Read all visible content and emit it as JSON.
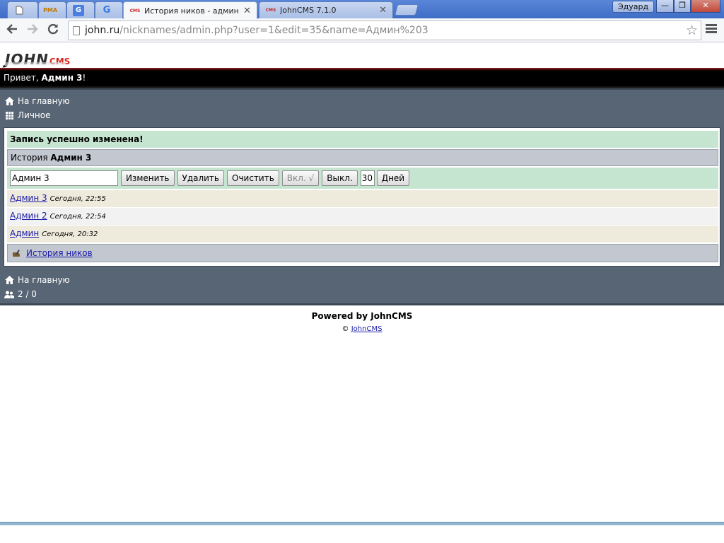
{
  "browser": {
    "tabs": [
      {
        "label": "",
        "favicon": "page-icon"
      },
      {
        "label": "",
        "favicon": "pma-icon",
        "favicon_text": "PMA"
      },
      {
        "label": "",
        "favicon": "google-translate-icon",
        "favicon_text": "G"
      },
      {
        "label": "",
        "favicon": "google-icon",
        "favicon_text": "G"
      },
      {
        "label": "История ников - админка",
        "favicon": "johncms-icon",
        "favicon_text": "CMS",
        "active": true
      },
      {
        "label": "JohnCMS 7.1.0",
        "favicon": "johncms-icon",
        "favicon_text": "CMS"
      }
    ],
    "profile_name": "Эдуард",
    "window_buttons": {
      "minimize": "—",
      "restore": "❐",
      "close": "✕"
    },
    "url_host": "john.ru",
    "url_path": "/nicknames/admin.php?user=1&edit=35&name=Админ%203"
  },
  "site": {
    "logo_main": "JOHN",
    "logo_sub": "CMS",
    "greeting": "Привет, ",
    "greeting_user": "Админ 3",
    "greeting_end": "!"
  },
  "nav_top": [
    {
      "label": "На главную",
      "icon": "home-icon"
    },
    {
      "label": "Личное",
      "icon": "grid-icon"
    }
  ],
  "content": {
    "success_message": "Запись успешно изменена!",
    "history_label": "История ",
    "history_user": "Админ 3",
    "nick_input_value": "Админ 3",
    "buttons": {
      "edit": "Изменить",
      "delete": "Удалить",
      "clear": "Очистить",
      "enable": "Вкл. √",
      "disable": "Выкл.",
      "days_value": "30",
      "days": "Дней"
    },
    "history": [
      {
        "name": "Админ 3",
        "when": "Сегодня, 22:55"
      },
      {
        "name": "Админ 2",
        "when": "Сегодня, 22:54"
      },
      {
        "name": "Админ",
        "when": "Сегодня, 20:32"
      }
    ],
    "footer_link": "История ников"
  },
  "nav_bottom": [
    {
      "label": "На главную",
      "icon": "home-icon"
    },
    {
      "label": "2 / 0",
      "icon": "users-icon"
    }
  ],
  "footer": {
    "powered": "Powered by JohnCMS",
    "copy_symbol": "©",
    "copy_link": "JohnCMS"
  }
}
